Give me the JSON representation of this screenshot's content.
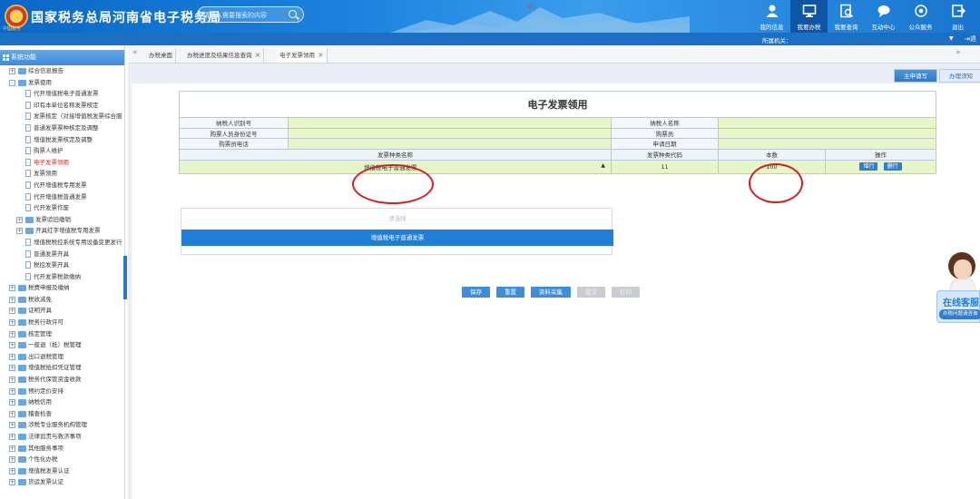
{
  "header": {
    "site_title": "国家税务总局河南省电子税务局",
    "emblem_text": "中国税务",
    "search_placeholder": "请输入需要搜索的内容",
    "nav": [
      {
        "label": "我的信息",
        "icon": "user-icon"
      },
      {
        "label": "我要办税",
        "icon": "monitor-icon",
        "active": true
      },
      {
        "label": "我要查询",
        "icon": "query-icon"
      },
      {
        "label": "互动中心",
        "icon": "chat-icon"
      },
      {
        "label": "公众服务",
        "icon": "service-icon"
      },
      {
        "label": "退出",
        "icon": "exit-icon"
      }
    ]
  },
  "subbar": {
    "org_label": "所属机关：",
    "exit_label": "退"
  },
  "sidebar": {
    "title": "系统功能",
    "items": [
      {
        "label": "综合信息报告",
        "type": "folder",
        "expand": "+",
        "level": 0
      },
      {
        "label": "发票使用",
        "type": "folder",
        "expand": "-",
        "level": 0
      },
      {
        "label": "代开增值税电子普通发票",
        "type": "doc",
        "level": 1
      },
      {
        "label": "印有本单位名称发票核定",
        "type": "doc",
        "level": 1
      },
      {
        "label": "发票核定（对接增值税发票综合服",
        "type": "doc",
        "level": 1
      },
      {
        "label": "普通发票票种核定及调整",
        "type": "doc",
        "level": 1
      },
      {
        "label": "增值税发票核定及调整",
        "type": "doc",
        "level": 1
      },
      {
        "label": "购票人维护",
        "type": "doc",
        "level": 1
      },
      {
        "label": "电子发票领用",
        "type": "doc",
        "level": 1,
        "selected": true
      },
      {
        "label": "发票领用",
        "type": "doc",
        "level": 1
      },
      {
        "label": "代开增值税专用发票",
        "type": "doc",
        "level": 1
      },
      {
        "label": "代开增值税普通发票",
        "type": "doc",
        "level": 1
      },
      {
        "label": "代开发票作废",
        "type": "doc",
        "level": 1
      },
      {
        "label": "发票验旧缴销",
        "type": "folder",
        "expand": "+",
        "level": 1
      },
      {
        "label": "开具红字增值税专用发票",
        "type": "folder",
        "expand": "+",
        "level": 1
      },
      {
        "label": "增值税税控系统专用设备变更发行",
        "type": "doc",
        "level": 1
      },
      {
        "label": "普通发票开具",
        "type": "doc",
        "level": 1
      },
      {
        "label": "税控发票开具",
        "type": "doc",
        "level": 1
      },
      {
        "label": "代开发票税款缴纳",
        "type": "doc",
        "level": 1
      },
      {
        "label": "税费申报及缴纳",
        "type": "folder",
        "expand": "+",
        "level": 0
      },
      {
        "label": "税收减免",
        "type": "folder",
        "expand": "+",
        "level": 0
      },
      {
        "label": "证明开具",
        "type": "folder",
        "expand": "+",
        "level": 0
      },
      {
        "label": "税务行政许可",
        "type": "folder",
        "expand": "+",
        "level": 0
      },
      {
        "label": "核定管理",
        "type": "folder",
        "expand": "+",
        "level": 0
      },
      {
        "label": "一般退（抵）税管理",
        "type": "folder",
        "expand": "+",
        "level": 0
      },
      {
        "label": "出口退税管理",
        "type": "folder",
        "expand": "+",
        "level": 0
      },
      {
        "label": "增值税抵扣凭证管理",
        "type": "folder",
        "expand": "+",
        "level": 0
      },
      {
        "label": "税务代保管资金收款",
        "type": "folder",
        "expand": "+",
        "level": 0
      },
      {
        "label": "预约定价安排",
        "type": "folder",
        "expand": "+",
        "level": 0
      },
      {
        "label": "纳税信用",
        "type": "folder",
        "expand": "+",
        "level": 0
      },
      {
        "label": "稽查检查",
        "type": "folder",
        "expand": "+",
        "level": 0
      },
      {
        "label": "涉税专业服务机构管理",
        "type": "folder",
        "expand": "+",
        "level": 0
      },
      {
        "label": "法律追责与救济事项",
        "type": "folder",
        "expand": "+",
        "level": 0
      },
      {
        "label": "其他服务事项",
        "type": "folder",
        "expand": "+",
        "level": 0
      },
      {
        "label": "个性化办税",
        "type": "folder",
        "expand": "+",
        "level": 0
      },
      {
        "label": "增值税发票认证",
        "type": "folder",
        "expand": "+",
        "level": 0
      },
      {
        "label": "货运发票认证",
        "type": "folder",
        "expand": "+",
        "level": 0
      }
    ]
  },
  "tabs": {
    "nav_left": "«",
    "nav_right": "»",
    "items": [
      {
        "label": "办税桌面",
        "closable": false
      },
      {
        "label": "办税进度及结果信息查询",
        "closable": true
      },
      {
        "label": "电子发票领用",
        "closable": true,
        "active": true
      }
    ],
    "close_glyph": "×"
  },
  "content_tabs": [
    {
      "label": "主申请写",
      "active": true
    },
    {
      "label": "办理须知",
      "active": false
    }
  ],
  "form": {
    "title": "电子发票领用",
    "labels": {
      "taxpayer_id": "纳税人识别号",
      "taxpayer_name": "纳税人名称",
      "buyer_id_no": "购票人员身份证号",
      "buyer": "购票员",
      "buyer_phone": "购票员电话",
      "apply_date": "申请日期"
    },
    "values": {
      "taxpayer_id": "",
      "taxpayer_name": "",
      "buyer_id_no": "",
      "buyer": "",
      "buyer_phone": "",
      "apply_date": ""
    },
    "columns": [
      "发票种类名称",
      "发票种类代码",
      "本数",
      "操作"
    ],
    "row": {
      "invoice_type": "增值税电子普通发票",
      "invoice_code": "11",
      "quantity": "100",
      "add_row": "增行",
      "delete_row": "删行"
    },
    "dropdown": {
      "placeholder": "请选择",
      "options": [
        "增值税电子普通发票"
      ],
      "selected": "增值税电子普通发票"
    }
  },
  "actions": [
    {
      "label": "保存",
      "enabled": true
    },
    {
      "label": "重置",
      "enabled": true
    },
    {
      "label": "资料采集",
      "enabled": true
    },
    {
      "label": "提交",
      "enabled": false
    },
    {
      "label": "打印",
      "enabled": false
    }
  ],
  "customer_service": {
    "title": "在线客服",
    "subtitle": "办税问题请咨询"
  },
  "colors": {
    "header_blue": "#1a82de",
    "accent_blue": "#2e7fd0",
    "highlight_green": "#e6f6c8",
    "annotation_red": "#d81e1e"
  }
}
